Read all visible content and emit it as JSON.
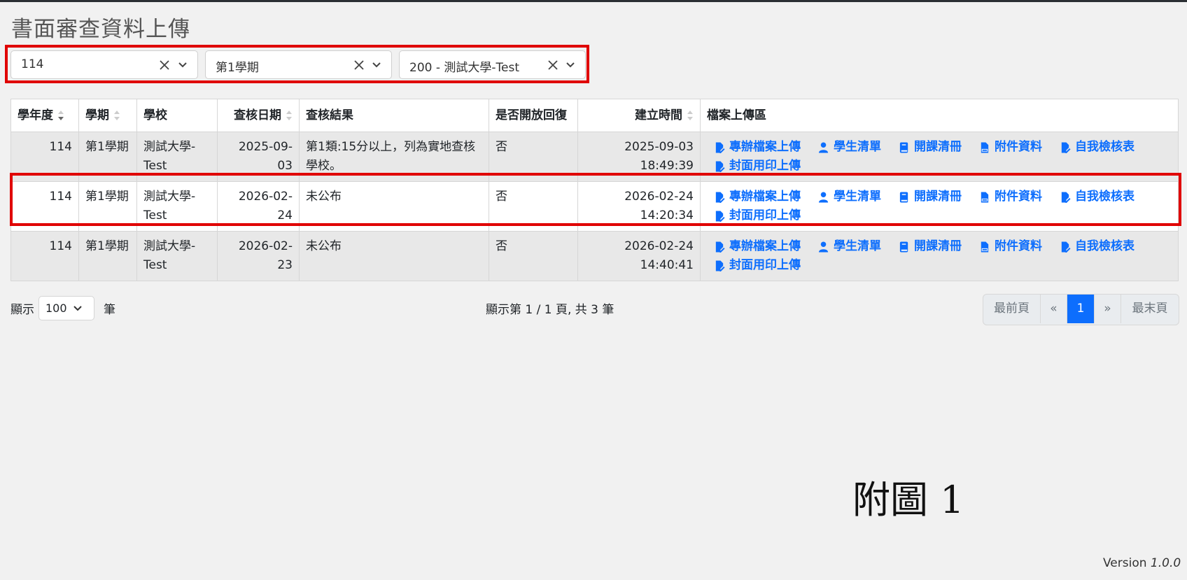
{
  "page": {
    "title": "書面審查資料上傳",
    "figure_label": "附圖 1",
    "version_label": "Version",
    "version_number": "1.0.0"
  },
  "filters": [
    {
      "value": "114"
    },
    {
      "value": "第1學期"
    },
    {
      "value": "200 - 測試大學-Test"
    }
  ],
  "table": {
    "columns": [
      "學年度",
      "學期",
      "學校",
      "查核日期",
      "查核結果",
      "是否開放回復",
      "建立時間",
      "檔案上傳區"
    ],
    "rows": [
      {
        "year": "114",
        "term": "第1學期",
        "school": "測試大學-Test",
        "review_date": "2025-09-03",
        "result": "第1類:15分以上，列為實地查核學校。",
        "open_reply": "否",
        "created": "2025-09-03 18:49:39"
      },
      {
        "year": "114",
        "term": "第1學期",
        "school": "測試大學-Test",
        "review_date": "2026-02-24",
        "result": "未公布",
        "open_reply": "否",
        "created": "2026-02-24 14:20:34"
      },
      {
        "year": "114",
        "term": "第1學期",
        "school": "測試大學-Test",
        "review_date": "2026-02-23",
        "result": "未公布",
        "open_reply": "否",
        "created": "2026-02-24 14:40:41"
      }
    ],
    "actions": [
      "專辦檔案上傳",
      "學生清單",
      "開課清冊",
      "附件資料",
      "自我檢核表",
      "封面用印上傳"
    ]
  },
  "footer": {
    "show_label": "顯示",
    "page_size": "100",
    "unit_label": "筆",
    "page_info": "顯示第 1 / 1 頁, 共 3 筆",
    "pager": {
      "first": "最前頁",
      "prev": "«",
      "current": "1",
      "next": "»",
      "last": "最末頁"
    }
  },
  "colors": {
    "accent": "#0d6efd",
    "highlight_frame": "#e00000"
  }
}
